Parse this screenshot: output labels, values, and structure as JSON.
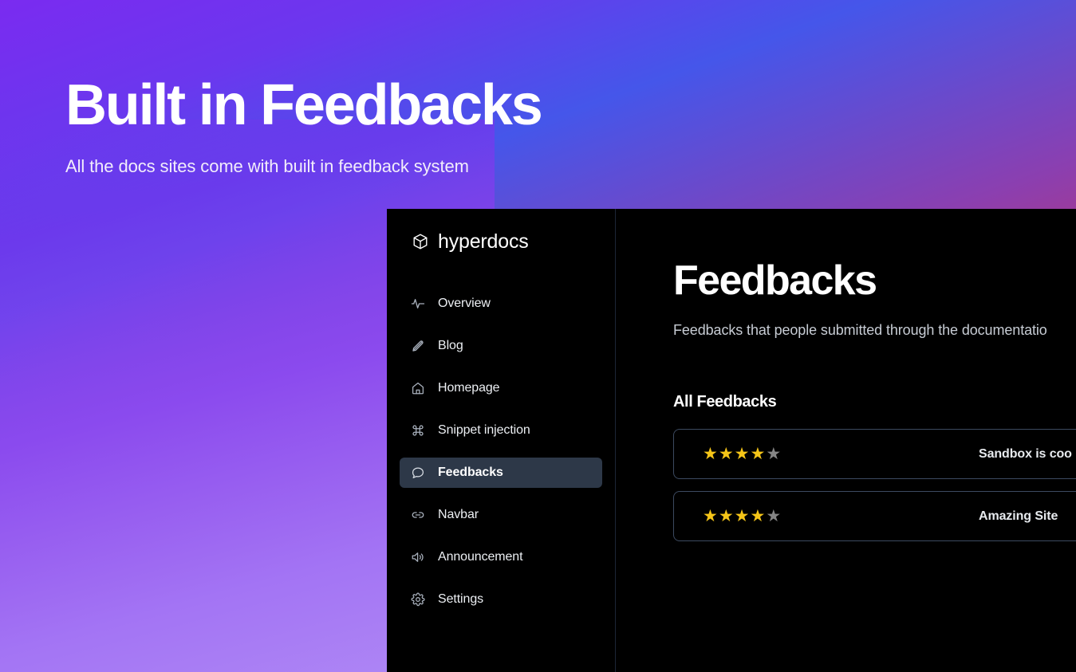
{
  "hero": {
    "title": "Built in Feedbacks",
    "subtitle": "All the docs sites come with built in feedback system"
  },
  "app": {
    "brand": {
      "name": "hyperdocs",
      "icon": "cube-icon"
    },
    "sidebar": {
      "items": [
        {
          "label": "Overview",
          "icon": "activity-icon",
          "active": false
        },
        {
          "label": "Blog",
          "icon": "pencil-icon",
          "active": false
        },
        {
          "label": "Homepage",
          "icon": "home-icon",
          "active": false
        },
        {
          "label": "Snippet injection",
          "icon": "command-icon",
          "active": false
        },
        {
          "label": "Feedbacks",
          "icon": "chat-icon",
          "active": true
        },
        {
          "label": "Navbar",
          "icon": "link-icon",
          "active": false
        },
        {
          "label": "Announcement",
          "icon": "speaker-icon",
          "active": false
        },
        {
          "label": "Settings",
          "icon": "gear-icon",
          "active": false
        }
      ]
    },
    "main": {
      "title": "Feedbacks",
      "subtitle": "Feedbacks that people submitted through the documentatio",
      "section_title": "All Feedbacks",
      "feedbacks": [
        {
          "rating": 4,
          "max_rating": 5,
          "text": "Sandbox is coo"
        },
        {
          "rating": 4,
          "max_rating": 5,
          "text": "Amazing Site"
        }
      ]
    }
  },
  "colors": {
    "gradient_purple": "#7a2bf0",
    "gradient_blue": "#4556ea",
    "gradient_crimson": "#e8304f",
    "panel_background": "#000000",
    "active_item": "#2d3848",
    "card_border": "#3c4a60",
    "star_filled": "#f5c518",
    "star_empty": "#858585"
  }
}
